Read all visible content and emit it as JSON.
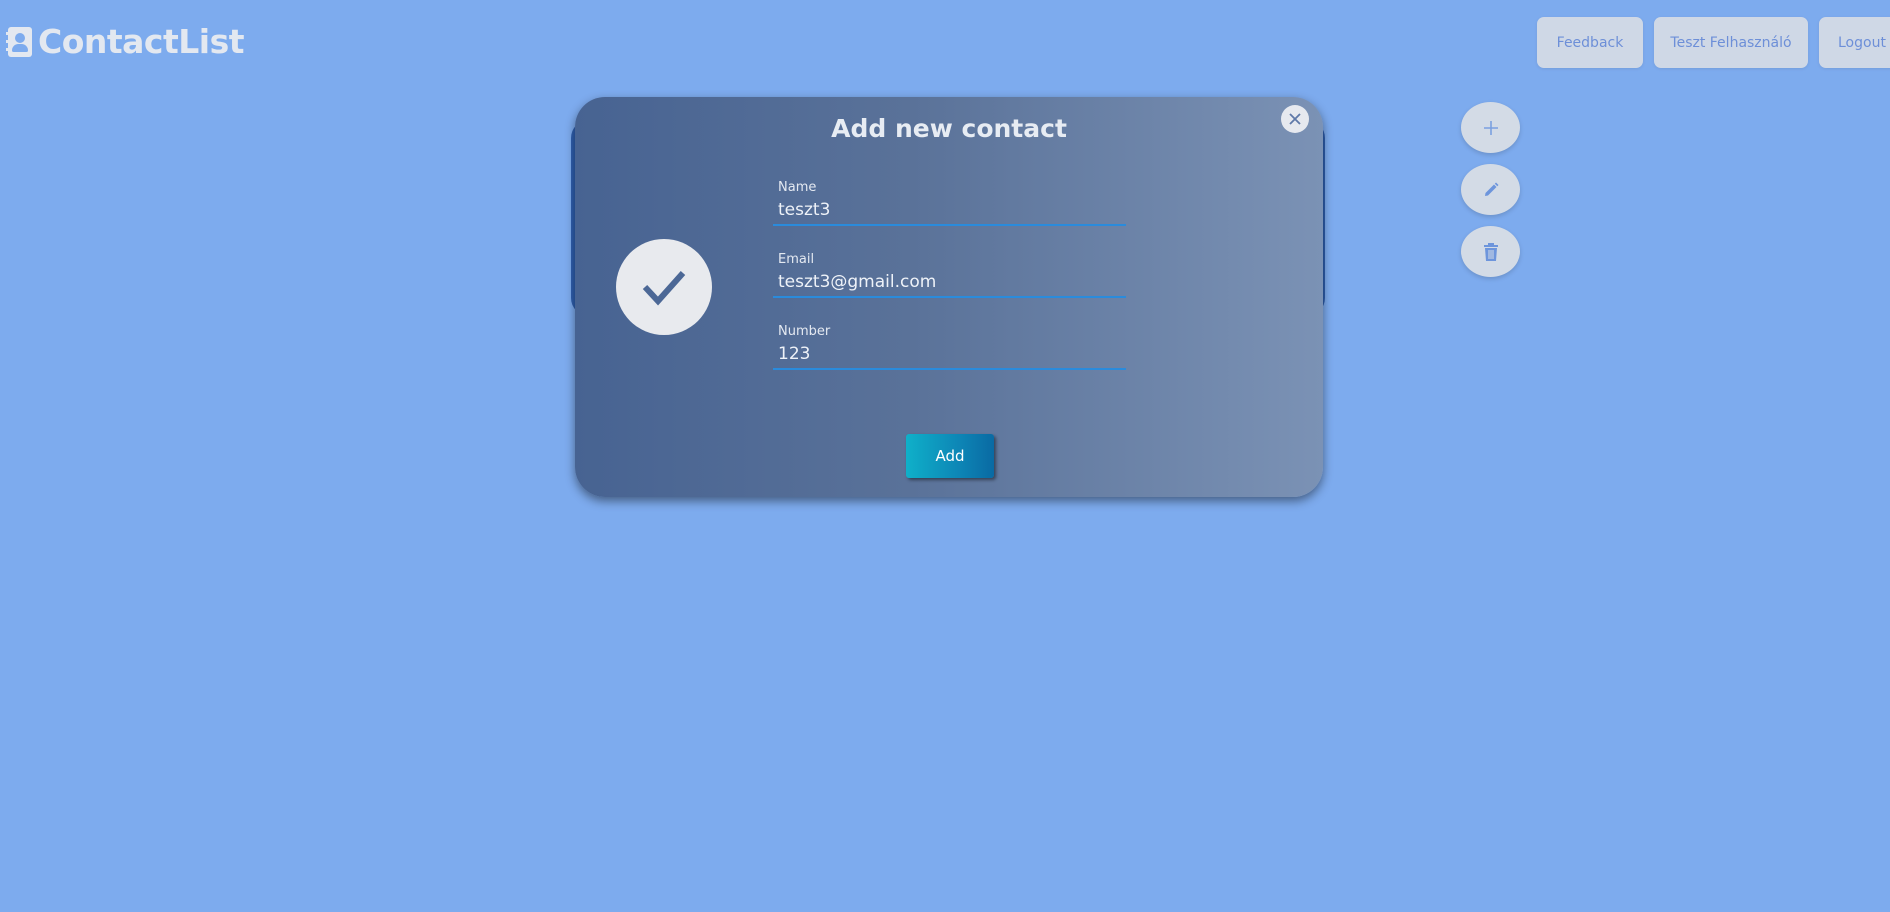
{
  "header": {
    "app_name": "ContactList",
    "logo_icon": "contact-card-icon"
  },
  "nav": {
    "feedback_label": "Feedback",
    "user_label": "Teszt Felhasználó",
    "logout_label": "Logout"
  },
  "actions": {
    "add_icon": "plus-icon",
    "edit_icon": "pencil-icon",
    "delete_icon": "trash-icon"
  },
  "modal": {
    "title": "Add new contact",
    "close_icon": "close-icon",
    "avatar_icon": "checkmark-icon",
    "fields": {
      "name": {
        "label": "Name",
        "value": "teszt3"
      },
      "email": {
        "label": "Email",
        "value": "teszt3@gmail.com"
      },
      "number": {
        "label": "Number",
        "value": "123"
      }
    },
    "submit_label": "Add"
  },
  "colors": {
    "background": "#7dabee",
    "button_bg": "#cfd8e6",
    "button_text": "#6d8fd8",
    "input_underline": "#2a8bdc",
    "submit_gradient_start": "#0fb0c9",
    "submit_gradient_end": "#0a6aa3"
  }
}
